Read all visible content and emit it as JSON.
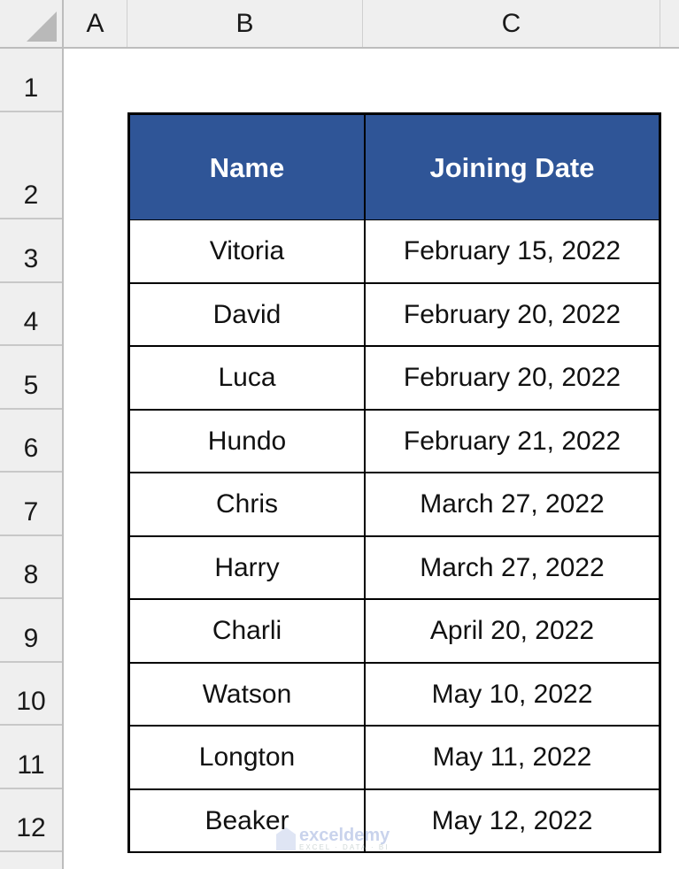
{
  "spreadsheet": {
    "columns": [
      "A",
      "B",
      "C"
    ],
    "rows": [
      "1",
      "2",
      "3",
      "4",
      "5",
      "6",
      "7",
      "8",
      "9",
      "10",
      "11",
      "12"
    ]
  },
  "table": {
    "headers": [
      "Name",
      "Joining Date"
    ],
    "rows": [
      {
        "name": "Vitoria",
        "date": "February 15, 2022"
      },
      {
        "name": "David",
        "date": "February 20, 2022"
      },
      {
        "name": "Luca",
        "date": "February 20, 2022"
      },
      {
        "name": "Hundo",
        "date": "February 21, 2022"
      },
      {
        "name": "Chris",
        "date": "March 27, 2022"
      },
      {
        "name": "Harry",
        "date": "March 27, 2022"
      },
      {
        "name": "Charli",
        "date": "April 20, 2022"
      },
      {
        "name": "Watson",
        "date": "May 10, 2022"
      },
      {
        "name": "Longton",
        "date": "May 11, 2022"
      },
      {
        "name": "Beaker",
        "date": "May 12, 2022"
      }
    ]
  },
  "colors": {
    "header_fill": "#2f5597",
    "header_text": "#ffffff"
  },
  "watermark": {
    "name": "exceldemy",
    "tagline": "EXCEL · DATA · BI"
  }
}
